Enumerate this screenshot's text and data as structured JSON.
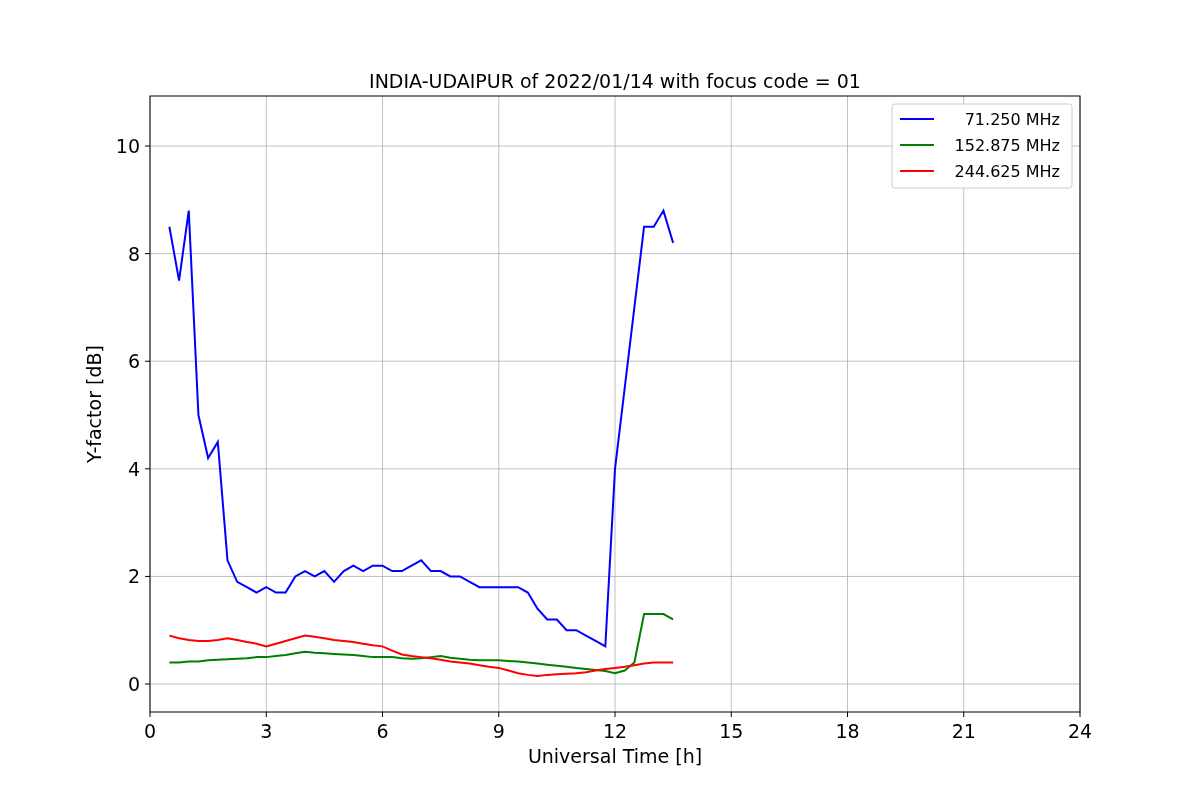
{
  "chart_data": {
    "type": "line",
    "title": "INDIA-UDAIPUR of 2022/01/14 with focus code = 01",
    "xlabel": "Universal Time [h]",
    "ylabel": "Y-factor [dB]",
    "x": [
      0.5,
      0.75,
      1.0,
      1.25,
      1.5,
      1.75,
      2.0,
      2.25,
      2.5,
      2.75,
      3.0,
      3.25,
      3.5,
      3.75,
      4.0,
      4.25,
      4.5,
      4.75,
      5.0,
      5.25,
      5.5,
      5.75,
      6.0,
      6.25,
      6.5,
      6.75,
      7.0,
      7.25,
      7.5,
      7.75,
      8.0,
      8.25,
      8.5,
      8.75,
      9.0,
      9.25,
      9.5,
      9.75,
      10.0,
      10.25,
      10.5,
      10.75,
      11.0,
      11.25,
      11.5,
      11.75,
      12.0,
      12.25,
      12.5,
      12.75,
      13.0,
      13.25,
      13.5
    ],
    "series": [
      {
        "name": "  71.250 MHz",
        "color": "#0000ff",
        "values": [
          8.5,
          7.5,
          8.8,
          5.0,
          4.2,
          4.5,
          2.3,
          1.9,
          1.8,
          1.7,
          1.8,
          1.7,
          1.7,
          2.0,
          2.1,
          2.0,
          2.1,
          1.9,
          2.1,
          2.2,
          2.1,
          2.2,
          2.2,
          2.1,
          2.1,
          2.2,
          2.3,
          2.1,
          2.1,
          2.0,
          2.0,
          1.9,
          1.8,
          1.8,
          1.8,
          1.8,
          1.8,
          1.7,
          1.4,
          1.2,
          1.2,
          1.0,
          1.0,
          0.9,
          0.8,
          0.7,
          4.0,
          5.5,
          7.0,
          8.5,
          8.5,
          8.8,
          8.2
        ]
      },
      {
        "name": "152.875 MHz",
        "color": "#008000",
        "values": [
          0.4,
          0.4,
          0.42,
          0.42,
          0.44,
          0.45,
          0.46,
          0.47,
          0.48,
          0.5,
          0.5,
          0.52,
          0.54,
          0.57,
          0.6,
          0.58,
          0.57,
          0.56,
          0.55,
          0.54,
          0.52,
          0.5,
          0.5,
          0.5,
          0.48,
          0.47,
          0.48,
          0.5,
          0.52,
          0.49,
          0.47,
          0.45,
          0.44,
          0.44,
          0.44,
          0.43,
          0.42,
          0.4,
          0.38,
          0.36,
          0.34,
          0.32,
          0.3,
          0.28,
          0.26,
          0.24,
          0.2,
          0.25,
          0.4,
          1.3,
          1.3,
          1.3,
          1.2
        ]
      },
      {
        "name": "244.625 MHz",
        "color": "#ff0000",
        "values": [
          0.9,
          0.85,
          0.82,
          0.8,
          0.8,
          0.82,
          0.85,
          0.82,
          0.78,
          0.75,
          0.7,
          0.75,
          0.8,
          0.85,
          0.9,
          0.88,
          0.85,
          0.82,
          0.8,
          0.78,
          0.75,
          0.72,
          0.7,
          0.62,
          0.55,
          0.52,
          0.5,
          0.48,
          0.45,
          0.42,
          0.4,
          0.38,
          0.35,
          0.32,
          0.3,
          0.25,
          0.2,
          0.17,
          0.15,
          0.17,
          0.18,
          0.19,
          0.2,
          0.22,
          0.25,
          0.28,
          0.3,
          0.32,
          0.35,
          0.38,
          0.4,
          0.4,
          0.4
        ]
      }
    ],
    "grid": true,
    "legend": "upper right",
    "xlim": [
      0,
      24
    ],
    "ylim": [
      -0.52,
      10.93
    ],
    "xticks": [
      0,
      3,
      6,
      9,
      12,
      15,
      18,
      21,
      24
    ],
    "yticks": [
      0,
      2,
      4,
      6,
      8,
      10
    ]
  }
}
